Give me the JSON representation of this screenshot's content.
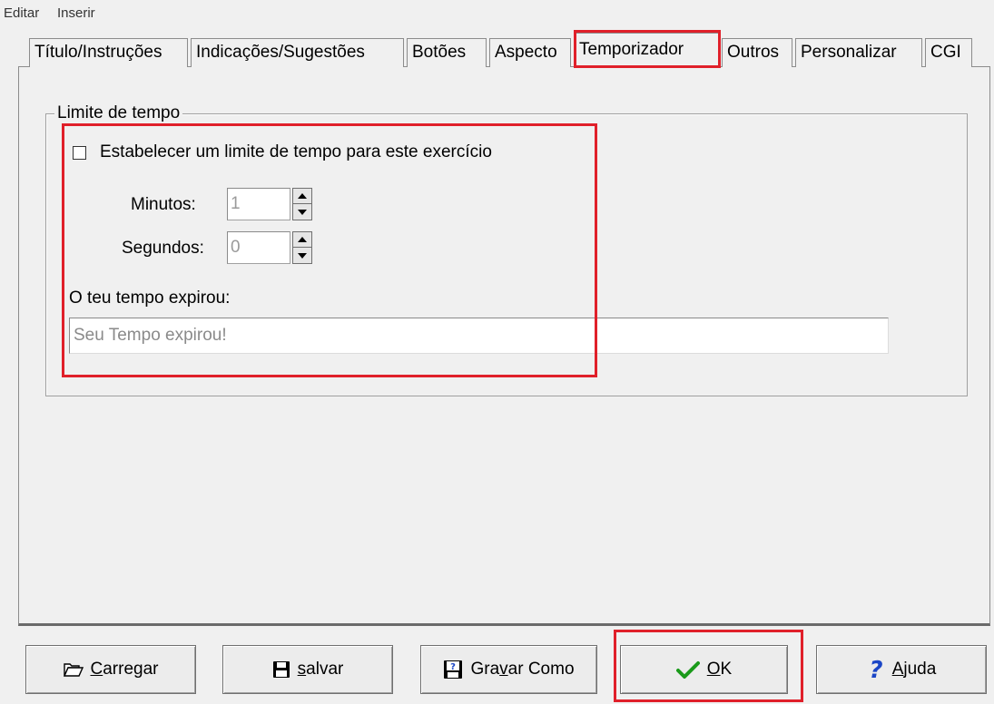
{
  "menu": {
    "items": [
      "Editar",
      "Inserir"
    ]
  },
  "tabs": [
    {
      "label": "Título/Instruções"
    },
    {
      "label": "Indicações/Sugestões"
    },
    {
      "label": "Botões"
    },
    {
      "label": "Aspecto"
    },
    {
      "label": "Temporizador",
      "active": true
    },
    {
      "label": "Outros"
    },
    {
      "label": "Personalizar"
    },
    {
      "label": "CGI"
    }
  ],
  "group": {
    "legend": "Limite de tempo",
    "checkbox_label": "Estabelecer um limite de tempo para este exercício",
    "checkbox_checked": false,
    "minutes_label": "Minutos:",
    "minutes_value": "1",
    "seconds_label": "Segundos:",
    "seconds_value": "0",
    "expired_label": "O teu tempo expirou:",
    "expired_message": "Seu Tempo expirou!"
  },
  "buttons": {
    "load": {
      "pre": "",
      "accel": "C",
      "post": "arregar",
      "icon": "folder-open-icon"
    },
    "save": {
      "pre": "",
      "accel": "s",
      "post": "alvar",
      "icon": "floppy-disk-icon"
    },
    "save_as": {
      "pre": "Gra",
      "accel": "v",
      "post": "ar Como",
      "icon": "save-as-icon"
    },
    "ok": {
      "pre": "",
      "accel": "O",
      "post": "K",
      "icon": "checkmark-icon"
    },
    "help": {
      "pre": "",
      "accel": "A",
      "post": "juda",
      "icon": "question-icon"
    }
  },
  "colors": {
    "highlight": "#e0202a",
    "ok_check": "#1a9a1a",
    "help_icon": "#1b46c6"
  }
}
